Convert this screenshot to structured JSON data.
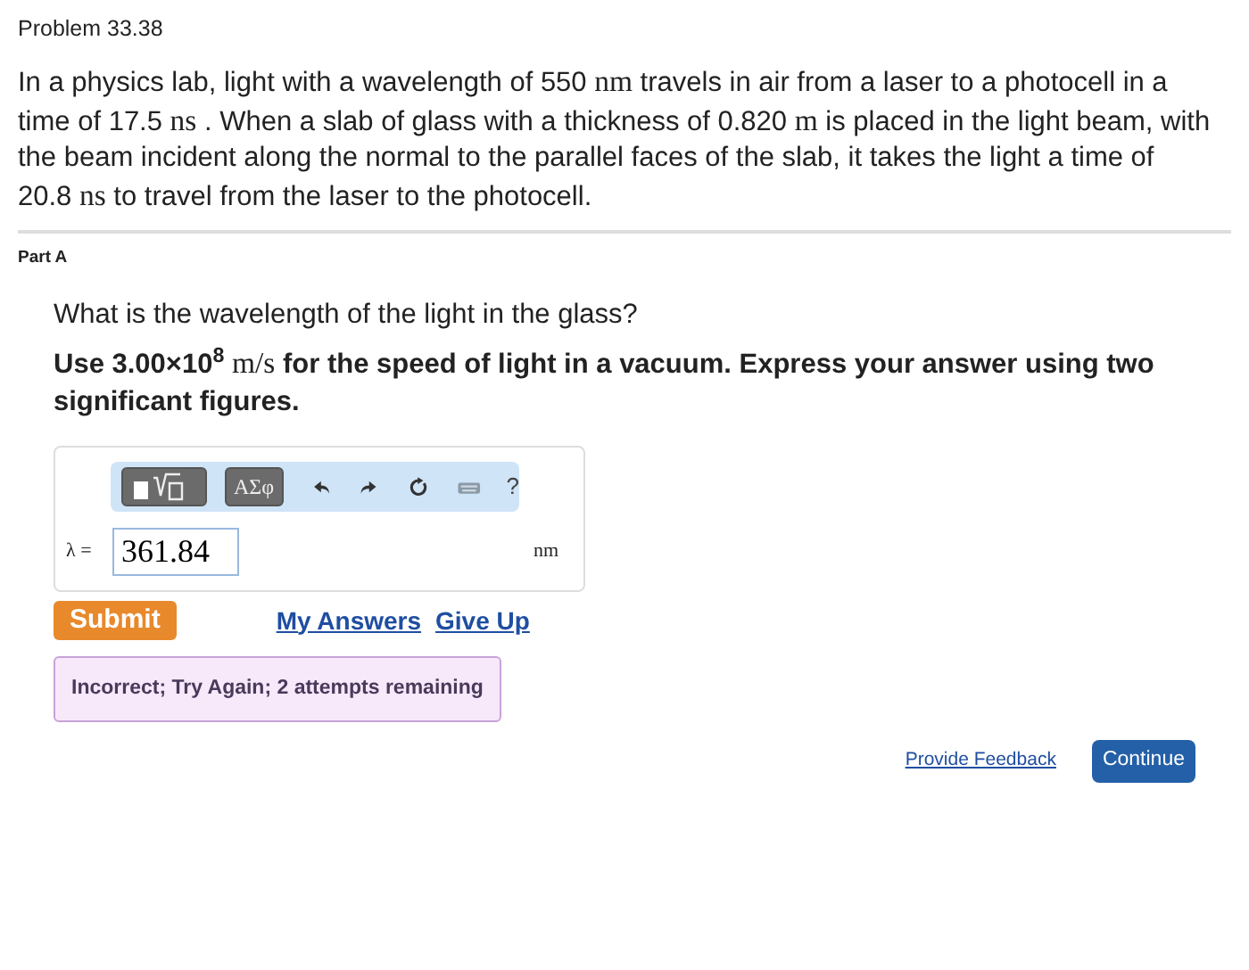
{
  "problem": {
    "title": "Problem 33.38",
    "text": [
      {
        "kind": "text",
        "text": "In a physics lab, light with a wavelength of 550 "
      },
      {
        "kind": "unit",
        "text": "nm"
      },
      {
        "kind": "text",
        "text": " travels in air from a laser to a photocell in a time of 17.5 "
      },
      {
        "kind": "unit",
        "text": "ns"
      },
      {
        "kind": "text",
        "text": " . When a slab of glass with a thickness of 0.820 "
      },
      {
        "kind": "unit",
        "text": "m"
      },
      {
        "kind": "text",
        "text": " is placed in the light beam, with the beam incident along the normal to the parallel faces of the slab, it takes the light a time of 20.8 "
      },
      {
        "kind": "unit",
        "text": "ns"
      },
      {
        "kind": "text",
        "text": " to travel from the laser to the photocell."
      }
    ]
  },
  "part": {
    "title": "Part A",
    "question": "What is the wavelength of the light in the glass?",
    "instruction": [
      {
        "kind": "text",
        "text": "Use 3.00×10$^{8}$ "
      },
      {
        "kind": "unit",
        "text": "m/s"
      },
      {
        "kind": "text",
        "text": " for the speed of light in a vacuum. Express your answer using two significant figures."
      }
    ]
  },
  "toolbar": {
    "template_buttons": [
      {
        "kind": "template"
      },
      {
        "kind": "symbols",
        "label": "ΑΣφ"
      }
    ],
    "help": "?"
  },
  "answer": {
    "label": "λ =",
    "value": "361.84",
    "unit": "nm"
  },
  "actions": {
    "submit": "Submit",
    "links": [
      "My Answers",
      "Give Up"
    ]
  },
  "feedback": "Incorrect; Try Again; 2 attempts remaining",
  "footer": {
    "link": "Provide Feedback",
    "button": "Continue"
  }
}
